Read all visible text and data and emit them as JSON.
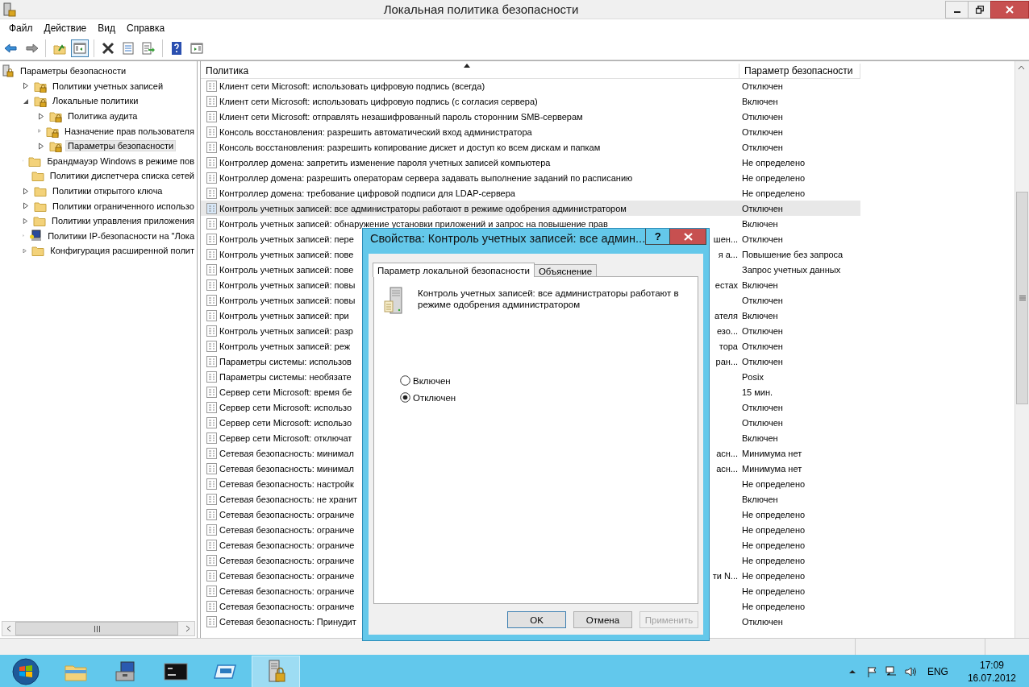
{
  "window": {
    "title": "Локальная политика безопасности"
  },
  "menu": [
    "Файл",
    "Действие",
    "Вид",
    "Справка"
  ],
  "toolbar": [
    [
      {
        "kind": "back",
        "pressed": false
      },
      {
        "kind": "forward",
        "pressed": false
      }
    ],
    [
      {
        "kind": "up",
        "pressed": false
      },
      {
        "kind": "tree",
        "pressed": true
      }
    ],
    [
      {
        "kind": "delete",
        "pressed": false
      },
      {
        "kind": "properties",
        "pressed": false
      },
      {
        "kind": "export",
        "pressed": false
      }
    ],
    [
      {
        "kind": "help",
        "pressed": false
      },
      {
        "kind": "pane",
        "pressed": false
      }
    ]
  ],
  "tree": {
    "label": "Параметры безопасности",
    "kind": "server",
    "selected": false,
    "children": [
      {
        "label": "Политики учетных записей",
        "kind": "locked",
        "selected": false,
        "expandable": true,
        "expanded": false
      },
      {
        "label": "Локальные политики",
        "kind": "locked",
        "selected": false,
        "expandable": true,
        "expanded": true,
        "children": [
          {
            "label": "Политика аудита",
            "kind": "locked",
            "selected": false,
            "expandable": true,
            "expanded": false
          },
          {
            "label": "Назначение прав пользователя",
            "kind": "locked",
            "selected": false,
            "expandable": true,
            "expanded": false
          },
          {
            "label": "Параметры безопасности",
            "kind": "locked",
            "selected": true,
            "expandable": true,
            "expanded": false
          }
        ]
      },
      {
        "label": "Брандмауэр Windows в режиме пов",
        "kind": "folder",
        "selected": false,
        "expandable": true,
        "expanded": false
      },
      {
        "label": "Политики диспетчера списка сетей",
        "kind": "folder",
        "selected": false,
        "expandable": false,
        "expanded": false
      },
      {
        "label": "Политики открытого ключа",
        "kind": "folder",
        "selected": false,
        "expandable": true,
        "expanded": false
      },
      {
        "label": "Политики ограниченного использо",
        "kind": "folder",
        "selected": false,
        "expandable": true,
        "expanded": false
      },
      {
        "label": "Политики управления приложения",
        "kind": "folder",
        "selected": false,
        "expandable": true,
        "expanded": false
      },
      {
        "label": "Политики IP-безопасности на \"Лока",
        "kind": "computer",
        "selected": false,
        "expandable": true,
        "expanded": false
      },
      {
        "label": "Конфигурация расширенной полит",
        "kind": "folder",
        "selected": false,
        "expandable": true,
        "expanded": false
      }
    ]
  },
  "list": {
    "columns": [
      {
        "label": "Политика",
        "sorted": true
      },
      {
        "label": "Параметр безопасности",
        "sorted": false
      }
    ],
    "rows": [
      {
        "policy": "Клиент сети Microsoft: использовать цифровую подпись (всегда)",
        "value": "Отключен",
        "selected": false
      },
      {
        "policy": "Клиент сети Microsoft: использовать цифровую подпись (с согласия сервера)",
        "value": "Включен",
        "selected": false
      },
      {
        "policy": "Клиент сети Microsoft: отправлять незашифрованный пароль сторонним SMB-серверам",
        "value": "Отключен",
        "selected": false
      },
      {
        "policy": "Консоль восстановления: разрешить автоматический вход администратора",
        "value": "Отключен",
        "selected": false
      },
      {
        "policy": "Консоль восстановления: разрешить копирование дискет и доступ ко всем дискам и папкам",
        "value": "Отключен",
        "selected": false
      },
      {
        "policy": "Контроллер домена: запретить изменение пароля учетных записей компьютера",
        "value": "Не определено",
        "selected": false
      },
      {
        "policy": "Контроллер домена: разрешить операторам сервера задавать выполнение заданий по расписанию",
        "value": "Не определено",
        "selected": false
      },
      {
        "policy": "Контроллер домена: требование цифровой подписи для LDAP-сервера",
        "value": "Не определено",
        "selected": false
      },
      {
        "policy": "Контроль учетных записей: все администраторы работают в режиме одобрения администратором",
        "value": "Отключен",
        "selected": true
      },
      {
        "policy": "Контроль учетных записей: обнаружение установки приложений и запрос на повышение прав",
        "value": "Включен",
        "selected": false
      },
      {
        "policy": "Контроль учетных записей: пере",
        "tail": "шен...",
        "value": "Отключен",
        "selected": false
      },
      {
        "policy": "Контроль учетных записей: пове",
        "tail": "я а...",
        "value": "Повышение без запроса",
        "selected": false
      },
      {
        "policy": "Контроль учетных записей: пове",
        "value": "Запрос учетных данных",
        "selected": false
      },
      {
        "policy": "Контроль учетных записей: повы",
        "tail": "естах",
        "value": "Включен",
        "selected": false
      },
      {
        "policy": "Контроль учетных записей: повы",
        "value": "Отключен",
        "selected": false
      },
      {
        "policy": "Контроль учетных записей: при",
        "tail": "ателя",
        "value": "Включен",
        "selected": false
      },
      {
        "policy": "Контроль учетных записей: разр",
        "tail": "езо...",
        "value": "Отключен",
        "selected": false
      },
      {
        "policy": "Контроль учетных записей: реж",
        "tail": "тора",
        "value": "Отключен",
        "selected": false
      },
      {
        "policy": "Параметры системы: использов",
        "tail": "ран...",
        "value": "Отключен",
        "selected": false
      },
      {
        "policy": "Параметры системы: необязате",
        "value": "Posix",
        "selected": false
      },
      {
        "policy": "Сервер сети Microsoft: время бе",
        "value": "15 мин.",
        "selected": false
      },
      {
        "policy": "Сервер сети Microsoft: использо",
        "value": "Отключен",
        "selected": false
      },
      {
        "policy": "Сервер сети Microsoft: использо",
        "value": "Отключен",
        "selected": false
      },
      {
        "policy": "Сервер сети Microsoft: отключат",
        "value": "Включен",
        "selected": false
      },
      {
        "policy": "Сетевая безопасность: минимал",
        "tail": "асн...",
        "value": "Минимума нет",
        "selected": false
      },
      {
        "policy": "Сетевая безопасность: минимал",
        "tail": "асн...",
        "value": "Минимума нет",
        "selected": false
      },
      {
        "policy": "Сетевая безопасность: настройк",
        "value": "Не определено",
        "selected": false
      },
      {
        "policy": "Сетевая безопасность: не хранит",
        "value": "Включен",
        "selected": false
      },
      {
        "policy": "Сетевая безопасность: ограниче",
        "value": "Не определено",
        "selected": false
      },
      {
        "policy": "Сетевая безопасность: ограниче",
        "value": "Не определено",
        "selected": false
      },
      {
        "policy": "Сетевая безопасность: ограниче",
        "value": "Не определено",
        "selected": false
      },
      {
        "policy": "Сетевая безопасность: ограниче",
        "value": "Не определено",
        "selected": false
      },
      {
        "policy": "Сетевая безопасность: ограниче",
        "tail": "ти N...",
        "value": "Не определено",
        "selected": false
      },
      {
        "policy": "Сетевая безопасность: ограниче",
        "value": "Не определено",
        "selected": false
      },
      {
        "policy": "Сетевая безопасность: ограниче",
        "value": "Не определено",
        "selected": false
      },
      {
        "policy": "Сетевая безопасность: Принудит",
        "value": "Отключен",
        "selected": false
      }
    ]
  },
  "dialog": {
    "title": "Свойства: Контроль учетных записей: все админ...",
    "help": "?",
    "tabs": [
      {
        "label": "Параметр локальной безопасности",
        "selected": true
      },
      {
        "label": "Объяснение",
        "selected": false
      }
    ],
    "description": "Контроль учетных записей: все администраторы работают в режиме одобрения администратором",
    "options": [
      {
        "label": "Включен",
        "selected": false
      },
      {
        "label": "Отключен",
        "selected": true
      }
    ],
    "buttons": [
      {
        "label": "OK",
        "disabled": false,
        "default": true
      },
      {
        "label": "Отмена",
        "disabled": false,
        "default": false
      },
      {
        "label": "Применить",
        "disabled": true,
        "default": false
      }
    ]
  },
  "taskbar": {
    "apps": [
      {
        "kind": "explorer",
        "active": false
      },
      {
        "kind": "tools",
        "active": false
      },
      {
        "kind": "console",
        "active": false
      },
      {
        "kind": "shell",
        "active": false
      },
      {
        "kind": "policy",
        "active": true
      }
    ],
    "language": "ENG",
    "time": "17:09",
    "date": "16.07.2012"
  }
}
